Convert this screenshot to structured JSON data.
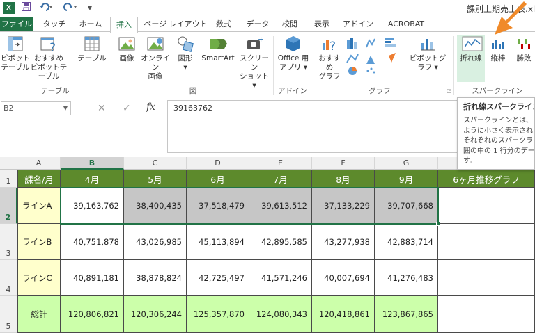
{
  "titlebar": {
    "app_logo": "X",
    "icons": [
      "save-icon",
      "undo-icon",
      "redo-icon",
      "customize-icon"
    ],
    "document_title": "課別上期売上表.xl"
  },
  "ribbon_tabs": [
    "ファイル",
    "タッチ",
    "ホーム",
    "挿入",
    "ページ レイアウト",
    "数式",
    "データ",
    "校閲",
    "表示",
    "アドイン",
    "ACROBAT"
  ],
  "active_tab": "挿入",
  "ribbon": {
    "groups": {
      "table": "テーブル",
      "illustrations": "図",
      "addins": "アドイン",
      "charts": "グラフ",
      "sparklines": "スパークライン"
    },
    "buttons": {
      "pivot_table": [
        "ピボット",
        "テーブル"
      ],
      "recommended_pivot": [
        "おすすめ",
        "ピボットテーブル"
      ],
      "table": "テーブル",
      "pictures": "画像",
      "online_pictures": [
        "オンライン",
        "画像"
      ],
      "shapes": "図形",
      "smartart": "SmartArt",
      "screenshot": [
        "スクリーン",
        "ショット"
      ],
      "office_apps": [
        "Office 用",
        "アプリ"
      ],
      "recommended_charts": [
        "おすすめ",
        "グラフ"
      ],
      "pivot_chart": "ピボットグラフ",
      "sparkline_line": "折れ線",
      "sparkline_column": "縦棒",
      "sparkline_winloss": "勝敗"
    },
    "accent_color": "#217346"
  },
  "formula_bar": {
    "name_box": "B2",
    "value": "39163762"
  },
  "tooltip": {
    "title": "折れ線スパークライン",
    "lines": [
      "スパークラインとは、1 つ",
      "ように小さく表示され",
      "それぞれのスパークライ",
      "囲の中の 1 行分のデー",
      "す。"
    ]
  },
  "sheet": {
    "column_letters": [
      "A",
      "B",
      "C",
      "D",
      "E",
      "F",
      "G"
    ],
    "row_numbers": [
      "1",
      "2",
      "3",
      "4",
      "5"
    ],
    "header": [
      "課名/月",
      "4月",
      "5月",
      "6月",
      "7月",
      "8月",
      "9月",
      "6ヶ月推移グラフ"
    ],
    "rows": [
      {
        "label": "ラインA",
        "values": [
          "39,163,762",
          "38,400,435",
          "37,518,479",
          "39,613,512",
          "37,133,229",
          "39,707,668"
        ]
      },
      {
        "label": "ラインB",
        "values": [
          "40,751,878",
          "43,026,985",
          "45,113,894",
          "42,895,585",
          "43,277,938",
          "42,883,714"
        ]
      },
      {
        "label": "ラインC",
        "values": [
          "40,891,181",
          "38,878,824",
          "42,725,497",
          "41,571,246",
          "40,007,694",
          "41,276,483"
        ]
      },
      {
        "label": "総計",
        "values": [
          "120,806,821",
          "120,306,244",
          "125,357,870",
          "124,080,343",
          "120,418,861",
          "123,867,865"
        ]
      }
    ],
    "colors": {
      "header_fill": "#5d8a2c",
      "label_fill": "#ffffcc",
      "selected_fill": "#c6c6c6",
      "total_fill": "#ccffaa"
    }
  }
}
